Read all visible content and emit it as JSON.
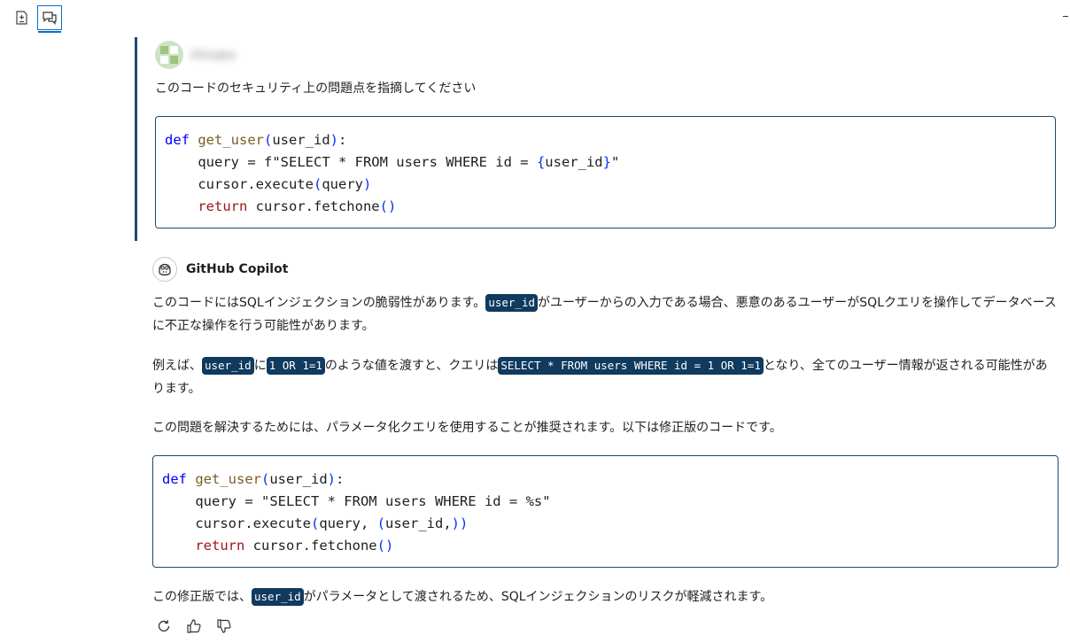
{
  "toolbar": {
    "new_chat_icon": "new-chat-icon",
    "chat_icon": "chat-icon"
  },
  "user": {
    "name": "Hinako",
    "message": "このコードのセキュリティ上の問題点を指摘してください"
  },
  "user_code": [
    "def get_user(user_id):",
    "    query = f\"SELECT * FROM users WHERE id = {user_id}\"",
    "    cursor.execute(query)",
    "    return cursor.fetchone()"
  ],
  "assistant": {
    "name": "GitHub Copilot",
    "p1": {
      "a": "このコードにはSQLインジェクションの脆弱性があります。",
      "code1": "user_id",
      "b": "がユーザーからの入力である場合、悪意のあるユーザーがSQLクエリを操作してデータベースに不正な操作を行う可能性があります。"
    },
    "p2": {
      "a": "例えば、",
      "code1": "user_id",
      "b": "に",
      "code2": "1 OR 1=1",
      "c": "のような値を渡すと、クエリは",
      "code3": "SELECT * FROM users WHERE id = 1 OR 1=1",
      "d": "となり、全てのユーザー情報が返される可能性があります。"
    },
    "p3": "この問題を解決するためには、パラメータ化クエリを使用することが推奨されます。以下は修正版のコードです。",
    "p4": {
      "a": "この修正版では、",
      "code1": "user_id",
      "b": "がパラメータとして渡されるため、SQLインジェクションのリスクが軽減されます。"
    }
  },
  "fixed_code": [
    "def get_user(user_id):",
    "    query = \"SELECT * FROM users WHERE id = %s\"",
    "    cursor.execute(query, (user_id,))",
    "    return cursor.fetchone()"
  ],
  "actions": [
    "retry-icon",
    "thumbs-up-icon",
    "thumbs-down-icon"
  ],
  "colors": {
    "accent": "#0e6fc4",
    "code_border": "#1b4a73",
    "inline_code_bg": "#103a5e"
  }
}
